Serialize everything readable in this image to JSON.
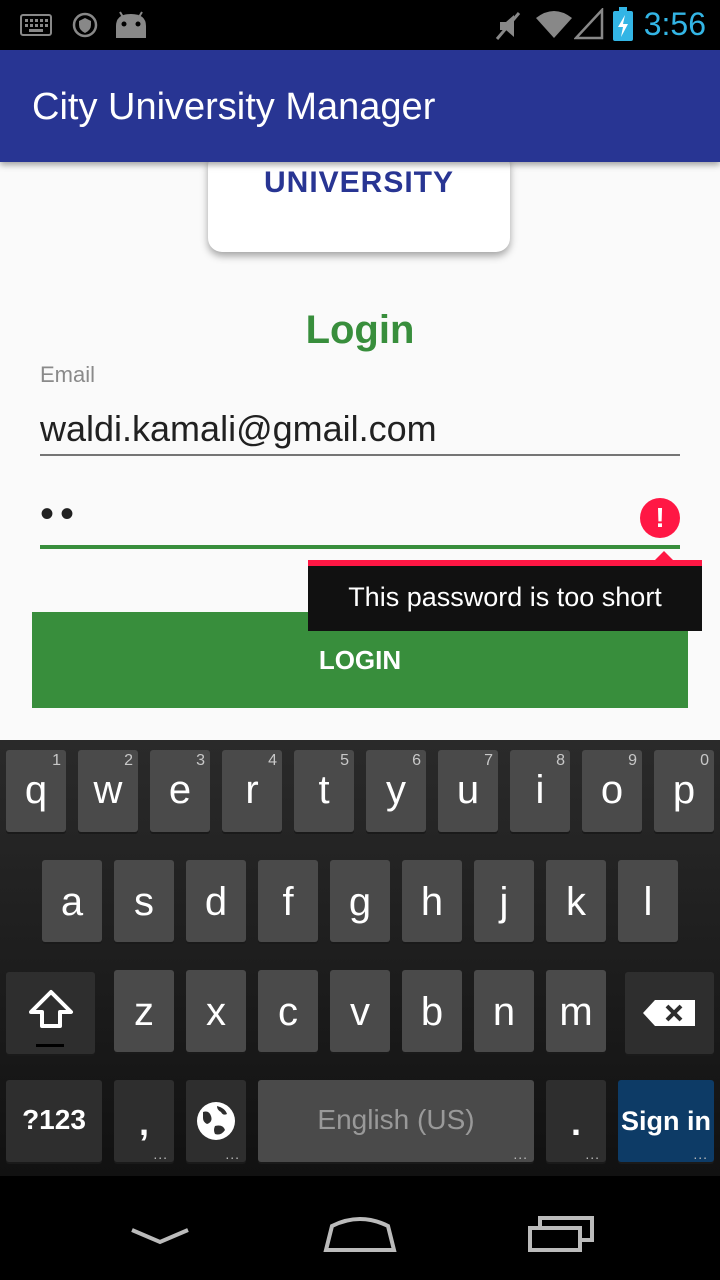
{
  "status_bar": {
    "time": "3:56",
    "icons": [
      "keyboard-icon",
      "vpn-icon",
      "android-debug-icon",
      "mute-icon",
      "wifi-icon",
      "signal-icon",
      "battery-charging-icon"
    ]
  },
  "app_bar": {
    "title": "City University Manager"
  },
  "logo": {
    "text": "UNIVERSITY"
  },
  "form": {
    "heading": "Login",
    "email_label": "Email",
    "email_value": "waldi.kamali@gmail.com",
    "password_value": "••",
    "error_message": "This password is too short",
    "login_button": "LOGIN"
  },
  "keyboard": {
    "row1": [
      {
        "key": "q",
        "hint": "1"
      },
      {
        "key": "w",
        "hint": "2"
      },
      {
        "key": "e",
        "hint": "3"
      },
      {
        "key": "r",
        "hint": "4"
      },
      {
        "key": "t",
        "hint": "5"
      },
      {
        "key": "y",
        "hint": "6"
      },
      {
        "key": "u",
        "hint": "7"
      },
      {
        "key": "i",
        "hint": "8"
      },
      {
        "key": "o",
        "hint": "9"
      },
      {
        "key": "p",
        "hint": "0"
      }
    ],
    "row2": [
      "a",
      "s",
      "d",
      "f",
      "g",
      "h",
      "j",
      "k",
      "l"
    ],
    "row3": [
      "z",
      "x",
      "c",
      "v",
      "b",
      "n",
      "m"
    ],
    "symbols_key": "?123",
    "comma_key": ",",
    "space_label": "English (US)",
    "period_key": ".",
    "action_key": "Sign in"
  },
  "colors": {
    "app_bar": "#283593",
    "accent_green": "#388e3c",
    "error_red": "#ff1744",
    "status_blue": "#33b5e5",
    "action_key_blue": "#0d3b66"
  }
}
